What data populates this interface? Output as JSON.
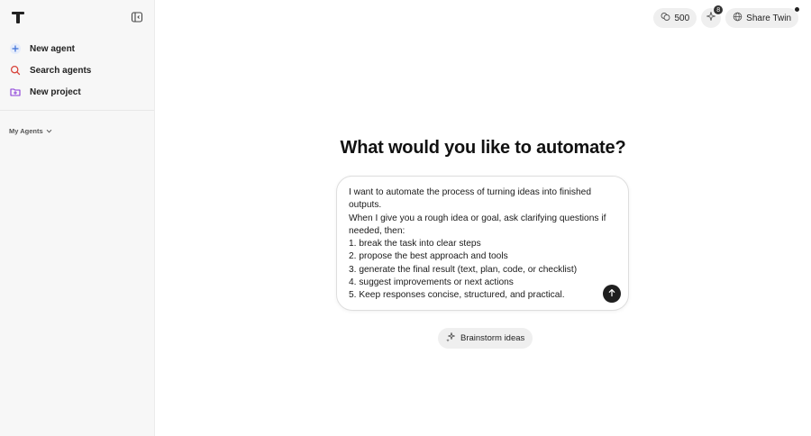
{
  "sidebar": {
    "items": [
      {
        "label": "New agent",
        "icon": "plus-icon"
      },
      {
        "label": "Search agents",
        "icon": "search-icon"
      },
      {
        "label": "New project",
        "icon": "folder-plus-icon"
      }
    ],
    "section_label": "My Agents"
  },
  "topbar": {
    "credits": "500",
    "notifications_count": "8",
    "share_label": "Share Twin"
  },
  "main": {
    "heading": "What would you like to automate?",
    "prompt_text": "I want to automate the process of turning ideas into finished outputs.\nWhen I give you a rough idea or goal, ask clarifying questions if needed, then:\n1. break the task into clear steps\n2. propose the best approach and tools\n3. generate the final result (text, plan, code, or checklist)\n4. suggest improvements or next actions\n5. Keep responses concise, structured, and practical.",
    "suggestion_label": "Brainstorm ideas"
  },
  "colors": {
    "accent_plus": "#3b6fd8",
    "accent_search": "#d8443b",
    "accent_folder": "#8a3bd8",
    "sidebar_bg": "#f7f7f7",
    "pill_bg": "#efefef"
  }
}
